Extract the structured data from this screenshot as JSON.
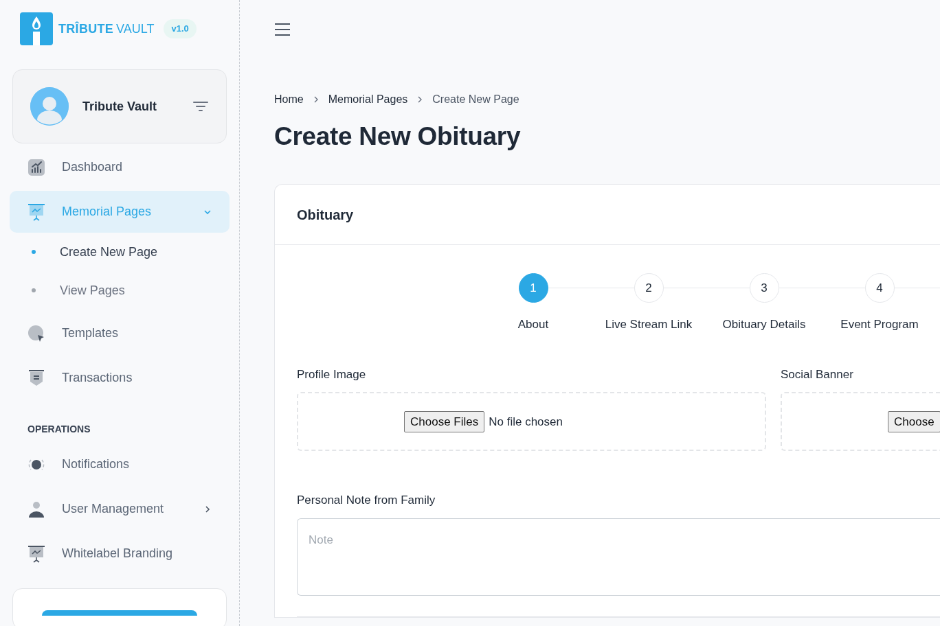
{
  "sidebar": {
    "brand": {
      "name_bold": "TRÎBUTE",
      "name_light": "VAULT",
      "version": "v1.0"
    },
    "profile": {
      "name": "Tribute Vault"
    },
    "items": [
      {
        "label": "Dashboard",
        "selected": false
      },
      {
        "label": "Memorial Pages",
        "selected": true,
        "expanded": true,
        "children": [
          {
            "label": "Create New Page",
            "selected": true
          },
          {
            "label": "View Pages",
            "selected": false
          }
        ]
      },
      {
        "label": "Templates",
        "selected": false
      },
      {
        "label": "Transactions",
        "selected": false
      }
    ],
    "section": {
      "title": "OPERATIONS",
      "items": [
        {
          "label": "Notifications",
          "selected": false
        },
        {
          "label": "User Management",
          "selected": false,
          "expanded": false
        },
        {
          "label": "Whitelabel Branding",
          "selected": false
        }
      ]
    }
  },
  "breadcrumb": [
    "Home",
    "Memorial Pages",
    "Create New Page"
  ],
  "page_title": "Create New Obituary",
  "card": {
    "title": "Obituary",
    "steps": [
      {
        "number": "1",
        "label": "About",
        "selected": true
      },
      {
        "number": "2",
        "label": "Live Stream Link",
        "selected": false
      },
      {
        "number": "3",
        "label": "Obituary Details",
        "selected": false
      },
      {
        "number": "4",
        "label": "Event Program",
        "selected": false
      }
    ],
    "uploads": [
      {
        "label": "Profile Image",
        "button": "Choose Files",
        "status": "No file chosen"
      },
      {
        "label": "Social Banner",
        "button": "Choose"
      }
    ],
    "note": {
      "label": "Personal Note from Family",
      "placeholder": "Note"
    }
  }
}
